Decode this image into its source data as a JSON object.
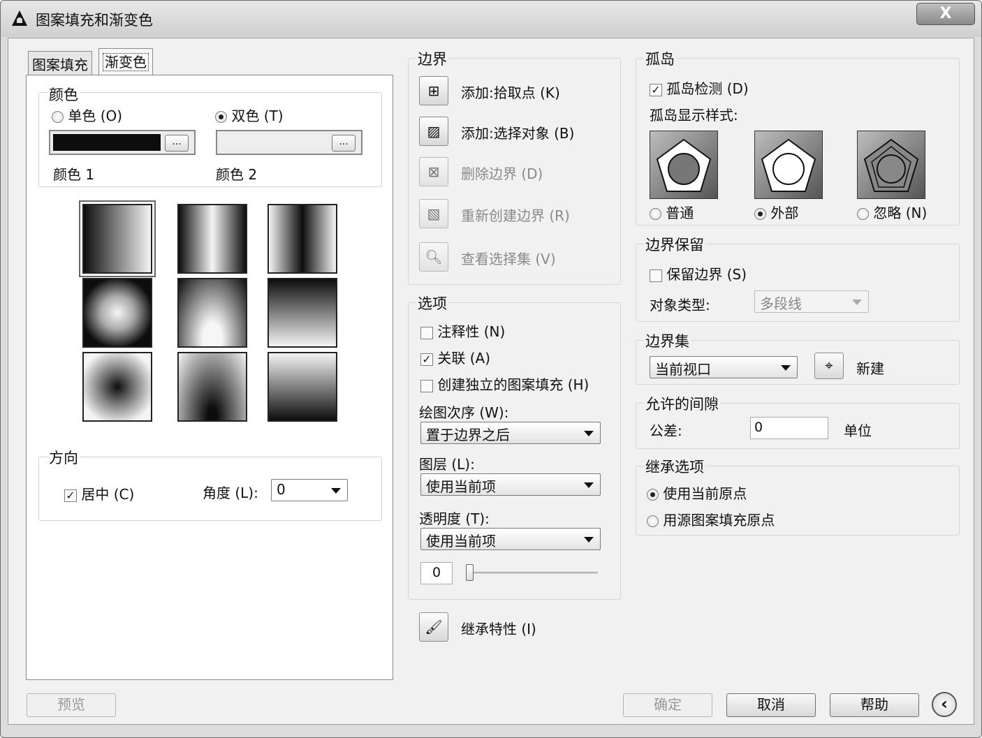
{
  "window": {
    "title": "图案填充和渐变色",
    "close_label": "X",
    "icon": "autocad-logo-icon"
  },
  "tabs": [
    {
      "label": "图案填充"
    },
    {
      "label": "渐变色"
    }
  ],
  "color": {
    "group_label": "颜色",
    "single_label": "单色 (O)",
    "dual_label": "双色 (T)",
    "color1_label": "颜色 1",
    "color2_label": "颜色 2",
    "browse_label": "...",
    "color1": "#0d0d0d",
    "color2": "#eeeeee"
  },
  "direction": {
    "group_label": "方向",
    "center_label": "居中 (C)",
    "angle_label": "角度 (L):",
    "angle_value": "0"
  },
  "boundary": {
    "group_label": "边界",
    "items": [
      {
        "label": "添加:拾取点 (K)",
        "icon": "pick-point-icon"
      },
      {
        "label": "添加:选择对象 (B)",
        "icon": "select-objects-icon"
      },
      {
        "label": "删除边界 (D)",
        "icon": "remove-boundary-icon"
      },
      {
        "label": "重新创建边界 (R)",
        "icon": "recreate-boundary-icon"
      },
      {
        "label": "查看选择集 (V)",
        "icon": "magnifier-icon"
      }
    ]
  },
  "options": {
    "group_label": "选项",
    "annotative_label": "注释性 (N)",
    "associative_label": "关联 (A)",
    "separate_label": "创建独立的图案填充 (H)",
    "draw_order_label": "绘图次序 (W):",
    "draw_order_value": "置于边界之后",
    "layer_label": "图层 (L):",
    "layer_value": "使用当前项",
    "transparency_label": "透明度 (T):",
    "transparency_value": "使用当前项",
    "transparency_number": "0"
  },
  "inherit": {
    "label": "继承特性 (I)",
    "icon": "inherit-brush-icon"
  },
  "islands": {
    "group_label": "孤岛",
    "detect_label": "孤岛检测 (D)",
    "style_label": "孤岛显示样式:",
    "normal_label": "普通",
    "outer_label": "外部",
    "ignore_label": "忽略 (N)"
  },
  "retain": {
    "group_label": "边界保留",
    "retain_label": "保留边界 (S)",
    "type_label": "对象类型:",
    "type_value": "多段线"
  },
  "boundary_set": {
    "group_label": "边界集",
    "value": "当前视口",
    "new_label": "新建",
    "icon": "crosshair-icon"
  },
  "gap": {
    "group_label": "允许的间隙",
    "tolerance_label": "公差:",
    "tolerance_value": "0",
    "unit_label": "单位"
  },
  "inherit_options": {
    "group_label": "继承选项",
    "current_origin_label": "使用当前原点",
    "source_origin_label": "用源图案填充原点"
  },
  "footer": {
    "preview_label": "预览",
    "ok_label": "确定",
    "cancel_label": "取消",
    "help_label": "帮助",
    "collapse_icon": "collapse-left-icon"
  }
}
